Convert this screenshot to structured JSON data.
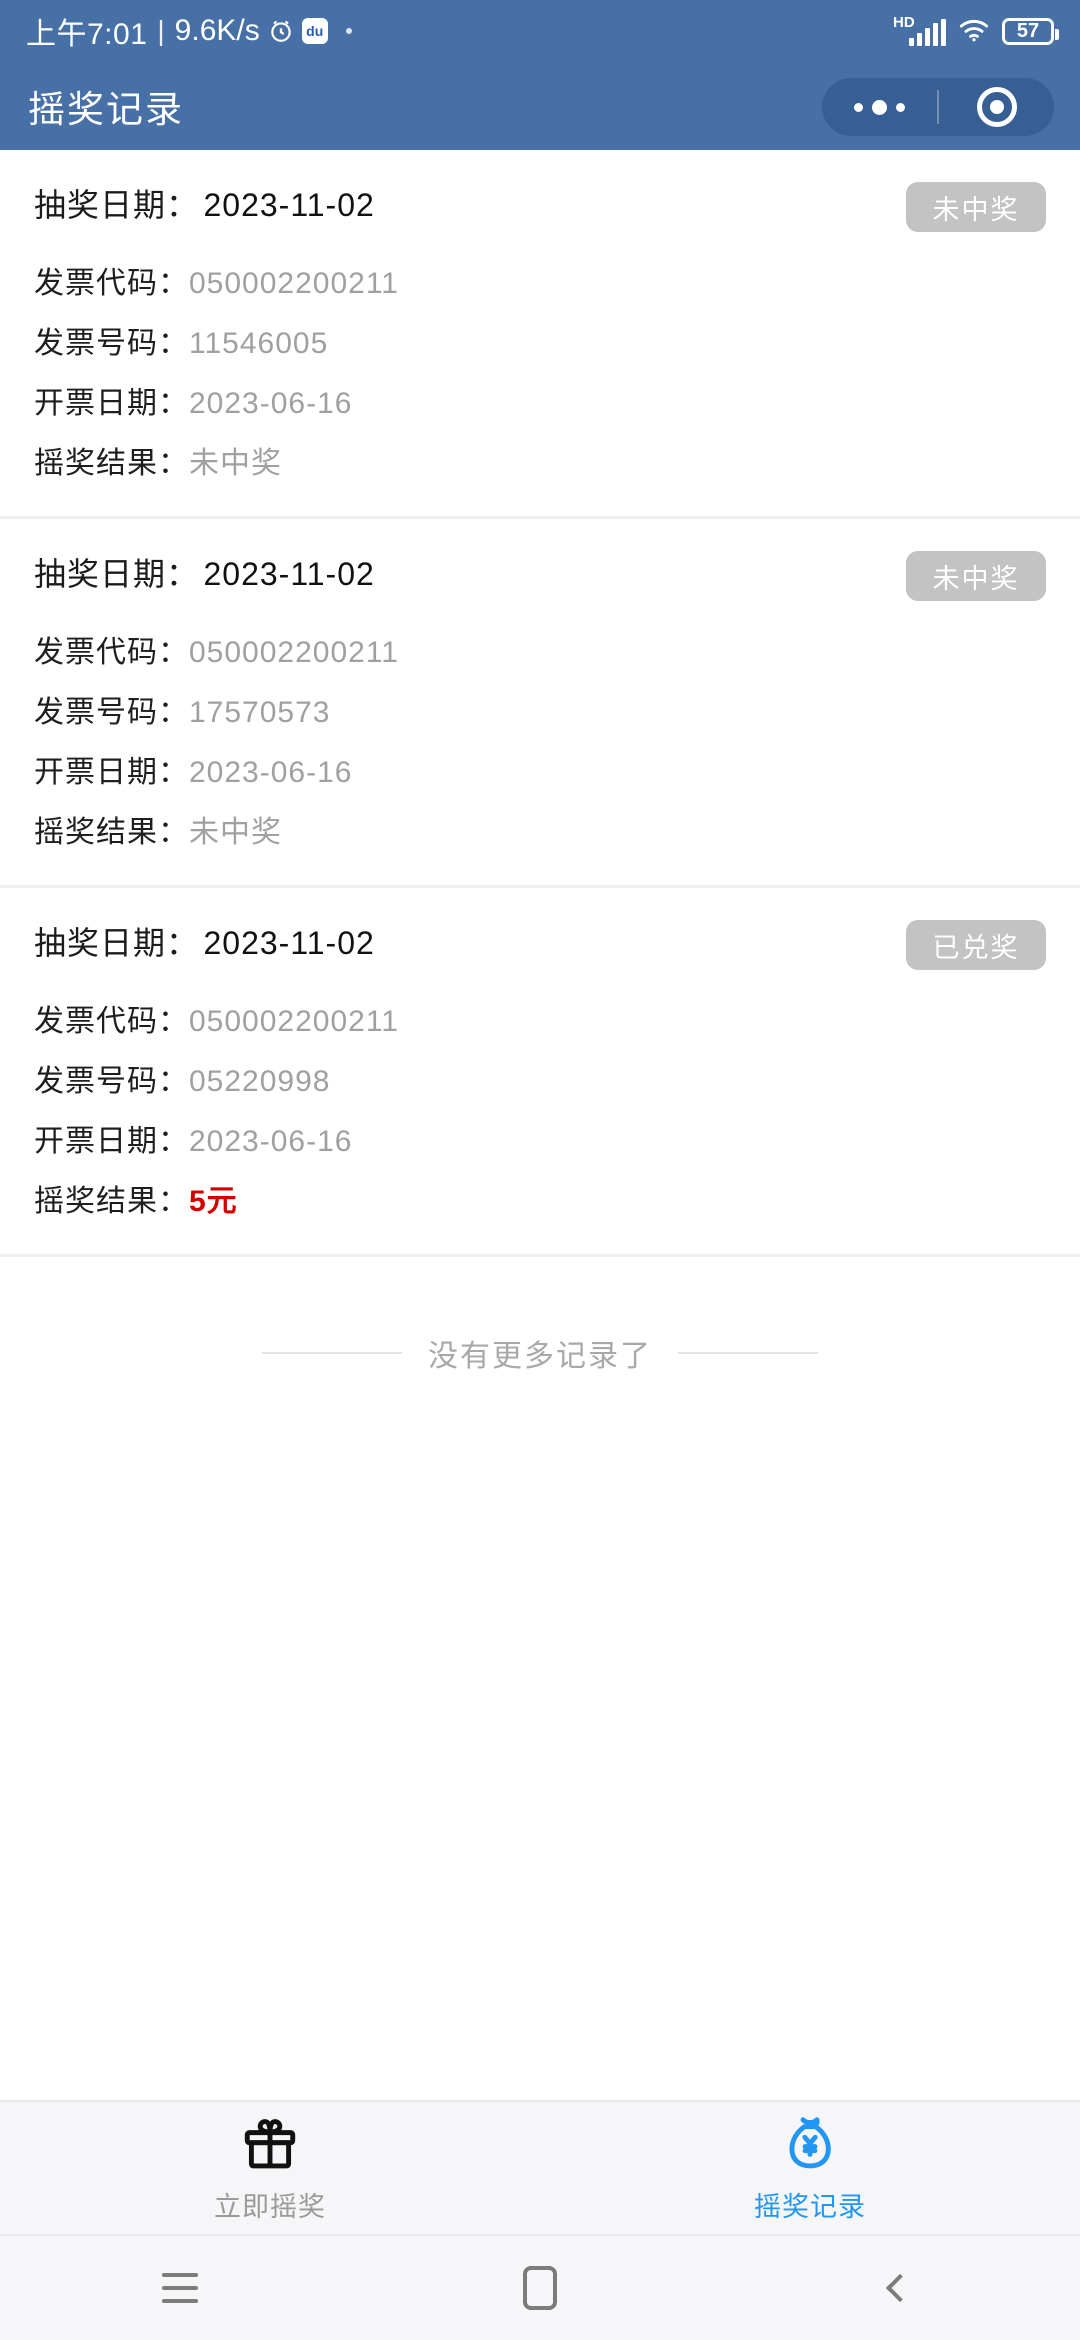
{
  "status_bar": {
    "time": "上午7:01",
    "separator": "|",
    "net_speed": "9.6K/s",
    "alarm_icon": "alarm-clock-icon",
    "app_icon_label": "du",
    "hd_label": "HD",
    "signal_icon": "signal-bars-icon",
    "wifi_icon": "wifi-icon",
    "battery_level": "57",
    "background_color": "#4770a6"
  },
  "nav_bar": {
    "title": "摇奖记录",
    "capsule": {
      "menu_icon": "more-dots-icon",
      "target_icon": "target-circle-icon"
    },
    "background_color": "#4770a6"
  },
  "labels": {
    "draw_date": "抽奖日期：",
    "invoice_code": "发票代码：",
    "invoice_number": "发票号码：",
    "issue_date": "开票日期：",
    "draw_result": "摇奖结果："
  },
  "records": [
    {
      "draw_date": "2023-11-02",
      "badge": "未中奖",
      "invoice_code": "050002200211",
      "invoice_number": "11546005",
      "issue_date": "2023-06-16",
      "draw_result": "未中奖",
      "is_prize": false
    },
    {
      "draw_date": "2023-11-02",
      "badge": "未中奖",
      "invoice_code": "050002200211",
      "invoice_number": "17570573",
      "issue_date": "2023-06-16",
      "draw_result": "未中奖",
      "is_prize": false
    },
    {
      "draw_date": "2023-11-02",
      "badge": "已兑奖",
      "invoice_code": "050002200211",
      "invoice_number": "05220998",
      "issue_date": "2023-06-16",
      "draw_result": "5元",
      "is_prize": true
    }
  ],
  "list_end": {
    "text": "没有更多记录了"
  },
  "tab_bar": {
    "items": [
      {
        "label": "立即摇奖",
        "icon": "gift-box-icon",
        "active": false
      },
      {
        "label": "摇奖记录",
        "icon": "money-bag-icon",
        "active": true
      }
    ],
    "active_color": "#2196f3",
    "inactive_color": "#9a9a9a"
  },
  "system_nav": {
    "menu_icon": "menu-icon",
    "home_icon": "home-square-icon",
    "back_icon": "back-chevron-icon"
  },
  "colors": {
    "brand": "#4770a6",
    "prize_red": "#d40000",
    "badge_gray": "#c3c3c3",
    "value_gray": "#a0a0a0"
  }
}
